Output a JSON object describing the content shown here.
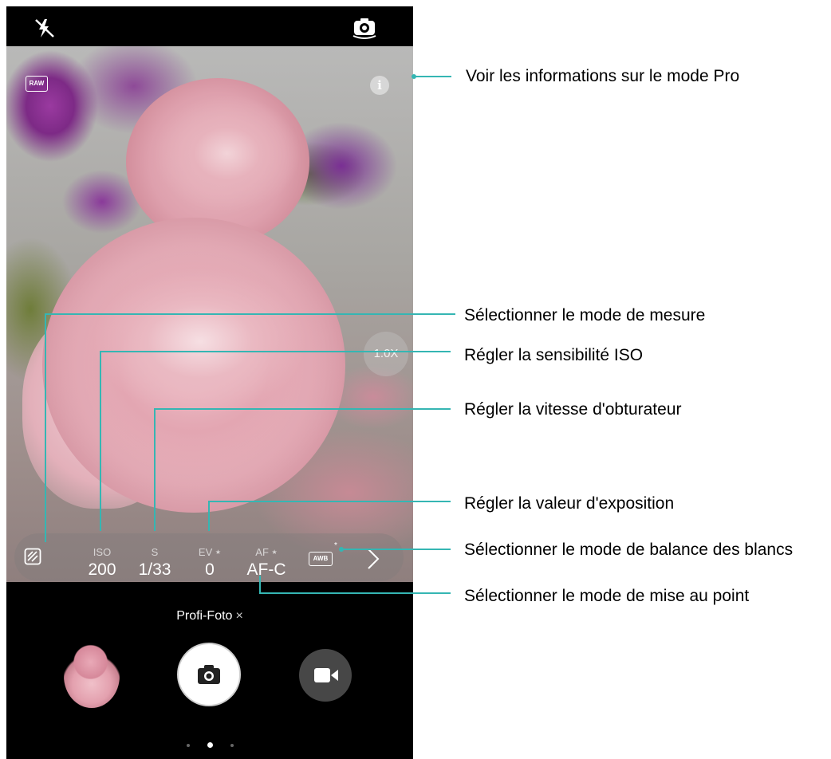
{
  "camera": {
    "raw_label": "RAW",
    "info_label": "i",
    "zoom_label": "1.0X",
    "pro_settings": [
      {
        "key": "iso",
        "label": "ISO",
        "value": "200",
        "star": ""
      },
      {
        "key": "s",
        "label": "S",
        "value": "1/33",
        "star": ""
      },
      {
        "key": "ev",
        "label": "EV",
        "value": "0",
        "star": "★"
      },
      {
        "key": "af",
        "label": "AF",
        "value": "AF-C",
        "star": "★"
      }
    ],
    "awb_label": "AWB",
    "awb_star": "*",
    "mode_name": "Profi-Foto",
    "mode_close": "×",
    "icons": {
      "flash": "flash-off-icon",
      "switch_camera": "switch-camera-icon",
      "metering": "metering-icon",
      "next": "chevron-right-icon",
      "shutter": "camera-icon",
      "video": "video-icon"
    }
  },
  "callouts": {
    "info": "Voir les informations sur le mode Pro",
    "metering": "Sélectionner le mode de mesure",
    "iso": "Régler la sensibilité ISO",
    "shutter_speed": "Régler la vitesse d'obturateur",
    "exposure": "Régler la valeur d'exposition",
    "white_balance": "Sélectionner le mode de balance des blancs",
    "focus": "Sélectionner le mode de mise au point"
  },
  "colors": {
    "callout_line": "#35b6b3",
    "background": "#ffffff"
  }
}
